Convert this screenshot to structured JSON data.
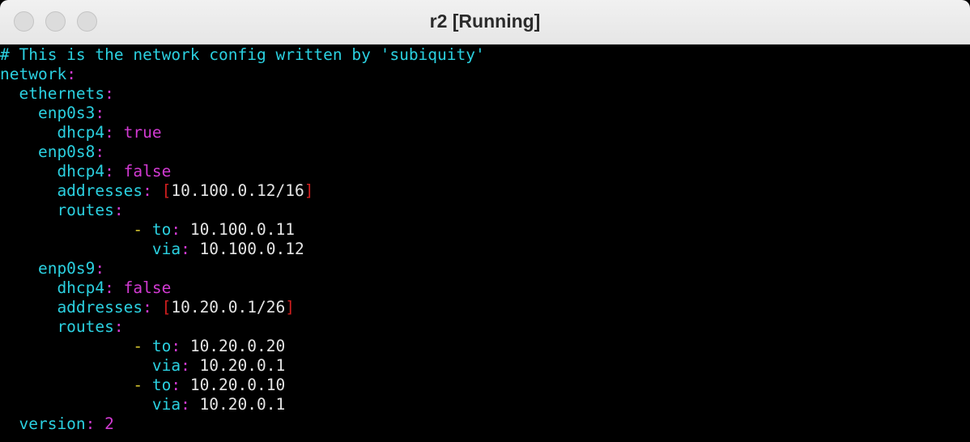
{
  "window": {
    "title": "r2 [Running]"
  },
  "terminal": {
    "lines": [
      [
        {
          "t": "# This is the network config written by 'subiquity'",
          "c": "cyan"
        }
      ],
      [
        {
          "t": "network",
          "c": "cyan"
        },
        {
          "t": ":",
          "c": "mag"
        }
      ],
      [
        {
          "t": "  ethernets",
          "c": "cyan"
        },
        {
          "t": ":",
          "c": "mag"
        }
      ],
      [
        {
          "t": "    enp0s3",
          "c": "cyan"
        },
        {
          "t": ":",
          "c": "mag"
        }
      ],
      [
        {
          "t": "      dhcp4",
          "c": "cyan"
        },
        {
          "t": ": ",
          "c": "mag"
        },
        {
          "t": "true",
          "c": "mag"
        }
      ],
      [
        {
          "t": "    enp0s8",
          "c": "cyan"
        },
        {
          "t": ":",
          "c": "mag"
        }
      ],
      [
        {
          "t": "      dhcp4",
          "c": "cyan"
        },
        {
          "t": ": ",
          "c": "mag"
        },
        {
          "t": "false",
          "c": "mag"
        }
      ],
      [
        {
          "t": "      addresses",
          "c": "cyan"
        },
        {
          "t": ": ",
          "c": "mag"
        },
        {
          "t": "[",
          "c": "red"
        },
        {
          "t": "10.100.0.12/16",
          "c": "wht"
        },
        {
          "t": "]",
          "c": "red"
        }
      ],
      [
        {
          "t": "      routes",
          "c": "cyan"
        },
        {
          "t": ":",
          "c": "mag"
        }
      ],
      [
        {
          "t": "              ",
          "c": "wht"
        },
        {
          "t": "- ",
          "c": "yel"
        },
        {
          "t": "to",
          "c": "cyan"
        },
        {
          "t": ": ",
          "c": "mag"
        },
        {
          "t": "10.100.0.11",
          "c": "wht"
        }
      ],
      [
        {
          "t": "                via",
          "c": "cyan"
        },
        {
          "t": ": ",
          "c": "mag"
        },
        {
          "t": "10.100.0.12",
          "c": "wht"
        }
      ],
      [
        {
          "t": "    enp0s9",
          "c": "cyan"
        },
        {
          "t": ":",
          "c": "mag"
        }
      ],
      [
        {
          "t": "      dhcp4",
          "c": "cyan"
        },
        {
          "t": ": ",
          "c": "mag"
        },
        {
          "t": "false",
          "c": "mag"
        }
      ],
      [
        {
          "t": "      addresses",
          "c": "cyan"
        },
        {
          "t": ": ",
          "c": "mag"
        },
        {
          "t": "[",
          "c": "red"
        },
        {
          "t": "10.20.0.1/26",
          "c": "wht"
        },
        {
          "t": "]",
          "c": "red"
        }
      ],
      [
        {
          "t": "      routes",
          "c": "cyan"
        },
        {
          "t": ":",
          "c": "mag"
        }
      ],
      [
        {
          "t": "              ",
          "c": "wht"
        },
        {
          "t": "- ",
          "c": "yel"
        },
        {
          "t": "to",
          "c": "cyan"
        },
        {
          "t": ": ",
          "c": "mag"
        },
        {
          "t": "10.20.0.20",
          "c": "wht"
        }
      ],
      [
        {
          "t": "                via",
          "c": "cyan"
        },
        {
          "t": ": ",
          "c": "mag"
        },
        {
          "t": "10.20.0.1",
          "c": "wht"
        }
      ],
      [
        {
          "t": "              ",
          "c": "wht"
        },
        {
          "t": "- ",
          "c": "yel"
        },
        {
          "t": "to",
          "c": "cyan"
        },
        {
          "t": ": ",
          "c": "mag"
        },
        {
          "t": "10.20.0.10",
          "c": "wht"
        }
      ],
      [
        {
          "t": "                via",
          "c": "cyan"
        },
        {
          "t": ": ",
          "c": "mag"
        },
        {
          "t": "10.20.0.1",
          "c": "wht"
        }
      ],
      [
        {
          "t": "  version",
          "c": "cyan"
        },
        {
          "t": ": ",
          "c": "mag"
        },
        {
          "t": "2",
          "c": "mag"
        }
      ],
      [
        {
          "t": "~",
          "c": "blue"
        }
      ]
    ]
  },
  "colors": {
    "cyan": "#2bd0e0",
    "magenta": "#d23ad2",
    "red": "#d21f1f",
    "yellow": "#d8c830",
    "white": "#e4e4e4",
    "blue": "#3a6cf0",
    "background": "#000000"
  }
}
